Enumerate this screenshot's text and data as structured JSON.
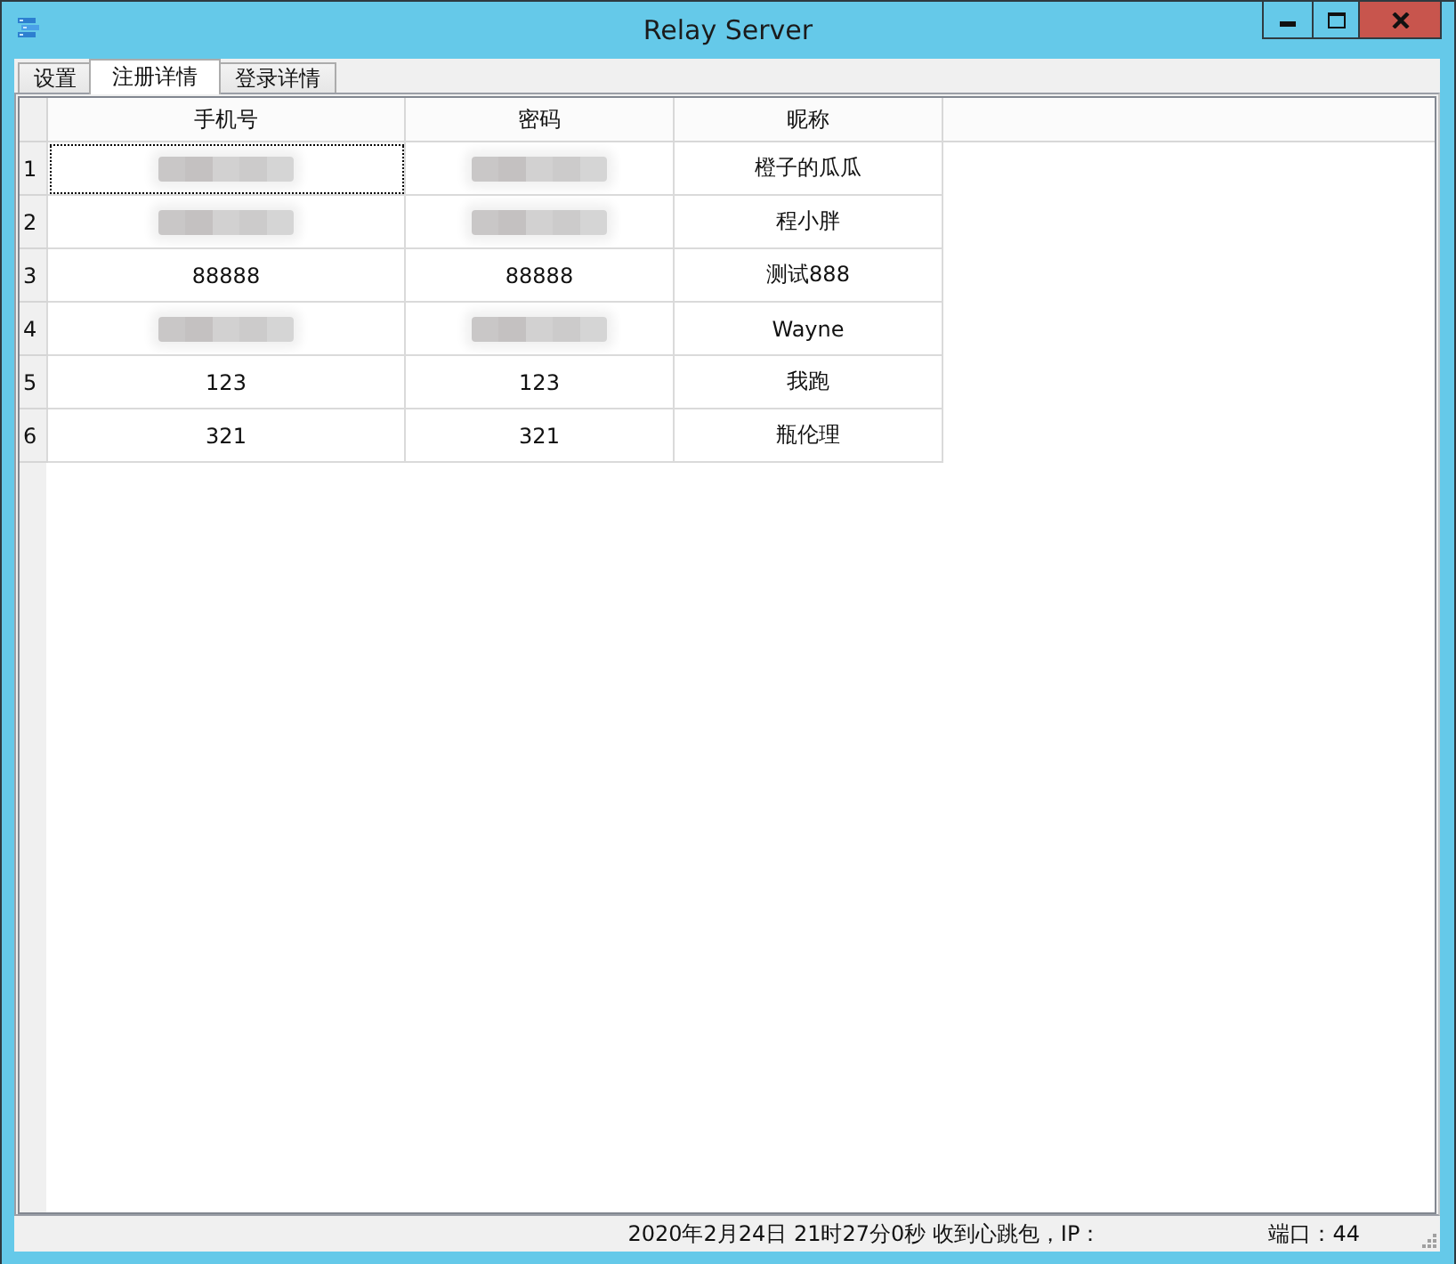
{
  "window": {
    "title": "Relay Server"
  },
  "tabs": [
    {
      "label": "设置",
      "selected": false
    },
    {
      "label": "注册详情",
      "selected": true
    },
    {
      "label": "登录详情",
      "selected": false
    }
  ],
  "table": {
    "columns": [
      "手机号",
      "密码",
      "昵称"
    ],
    "rows": [
      {
        "number": "1",
        "cells": [
          {
            "redacted": true,
            "focused": true
          },
          {
            "redacted": true,
            "focused": false
          },
          {
            "text": "橙子的瓜瓜",
            "redacted": false,
            "focused": false
          }
        ]
      },
      {
        "number": "2",
        "cells": [
          {
            "redacted": true,
            "focused": false
          },
          {
            "redacted": true,
            "focused": false
          },
          {
            "text": "程小胖",
            "redacted": false,
            "focused": false
          }
        ]
      },
      {
        "number": "3",
        "cells": [
          {
            "text": "88888",
            "redacted": false,
            "focused": false
          },
          {
            "text": "88888",
            "redacted": false,
            "focused": false
          },
          {
            "text": "测试888",
            "redacted": false,
            "focused": false
          }
        ]
      },
      {
        "number": "4",
        "cells": [
          {
            "redacted": true,
            "focused": false
          },
          {
            "redacted": true,
            "focused": false
          },
          {
            "text": "Wayne",
            "redacted": false,
            "focused": false
          }
        ]
      },
      {
        "number": "5",
        "cells": [
          {
            "text": "123",
            "redacted": false,
            "focused": false
          },
          {
            "text": "123",
            "redacted": false,
            "focused": false
          },
          {
            "text": "我跑",
            "redacted": false,
            "focused": false
          }
        ]
      },
      {
        "number": "6",
        "cells": [
          {
            "text": "321",
            "redacted": false,
            "focused": false
          },
          {
            "text": "321",
            "redacted": false,
            "focused": false
          },
          {
            "text": "瓶伦理",
            "redacted": false,
            "focused": false
          }
        ]
      }
    ]
  },
  "status_bar": {
    "texts": [
      "2020年2月24日 21时27分0秒 收到心跳包，IP：",
      "端口：44"
    ]
  }
}
